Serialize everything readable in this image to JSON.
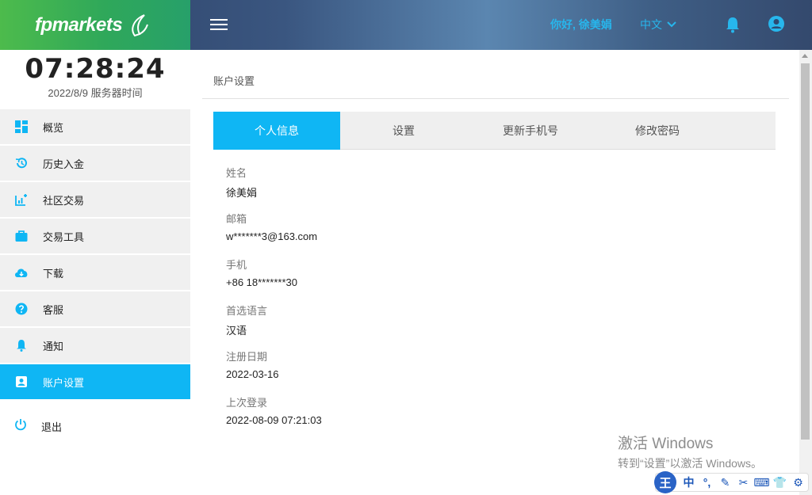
{
  "header": {
    "brand": "fpmarkets",
    "greeting": "你好, 徐美娟",
    "language": "中文"
  },
  "clock": {
    "time": "07:28:24",
    "date": "2022/8/9 服务器时间"
  },
  "sidebar": {
    "items": [
      {
        "label": "概览",
        "icon": "dashboard-icon"
      },
      {
        "label": "历史入金",
        "icon": "history-icon"
      },
      {
        "label": "社区交易",
        "icon": "chart-add-icon"
      },
      {
        "label": "交易工具",
        "icon": "briefcase-icon"
      },
      {
        "label": "下载",
        "icon": "cloud-download-icon"
      },
      {
        "label": "客服",
        "icon": "help-icon"
      },
      {
        "label": "通知",
        "icon": "bell-icon"
      },
      {
        "label": "账户设置",
        "icon": "account-box-icon",
        "active": true
      }
    ],
    "logout": "退出"
  },
  "main": {
    "page_title": "账户设置",
    "tabs": [
      {
        "label": "个人信息",
        "active": true
      },
      {
        "label": "设置"
      },
      {
        "label": "更新手机号"
      },
      {
        "label": "修改密码"
      }
    ],
    "fields": [
      {
        "label": "姓名",
        "value": "徐美娟"
      },
      {
        "label": "邮箱",
        "value": "w*******3@163.com"
      },
      {
        "label": "手机",
        "value": "+86 18*******30"
      },
      {
        "label": "首选语言",
        "value": "汉语"
      },
      {
        "label": "注册日期",
        "value": "2022-03-16"
      },
      {
        "label": "上次登录",
        "value": "2022-08-09 07:21:03"
      }
    ]
  },
  "windows_watermark": {
    "title": "激活 Windows",
    "subtitle": "转到“设置”以激活 Windows。"
  },
  "ime": {
    "logo": "王",
    "items": [
      "中",
      "°,",
      "✎",
      "✂",
      "⌨",
      "👕",
      "⚙"
    ]
  },
  "colors": {
    "accent": "#0fb6f4",
    "brand_green": "#2fa85a",
    "header_dark": "#2d3f63"
  }
}
